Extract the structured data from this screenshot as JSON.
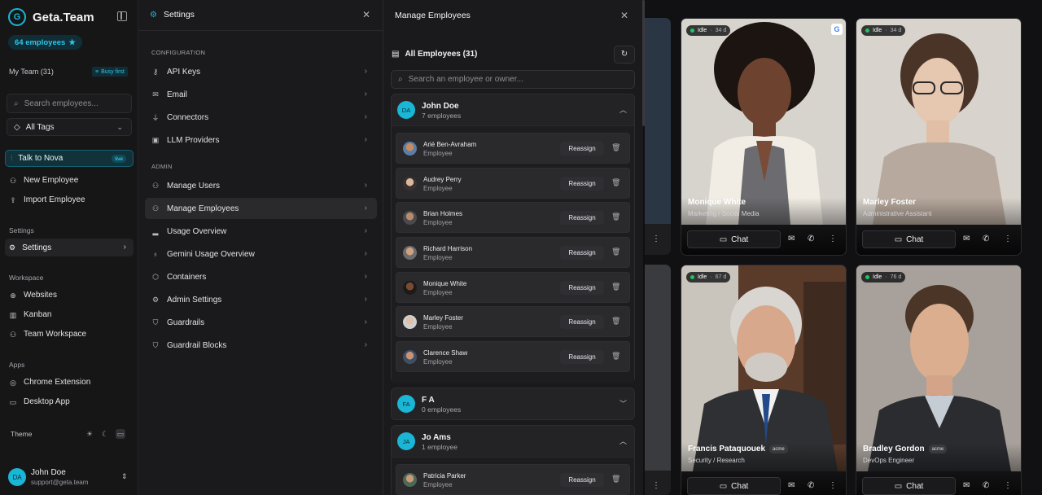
{
  "sidebar": {
    "brand": "Geta.Team",
    "logo_letter": "G",
    "employee_count": "64 employees",
    "my_team": "My Team (31)",
    "busy_first": "Busy first",
    "search_placeholder": "Search employees...",
    "tags_select": "All Tags",
    "talk_nova": "Talk to Nova",
    "live": "live",
    "new_employee": "New Employee",
    "import_employee": "Import Employee",
    "settings_section": "Settings",
    "settings_item": "Settings",
    "workspace_section": "Workspace",
    "websites": "Websites",
    "kanban": "Kanban",
    "team_workspace": "Team Workspace",
    "apps_section": "Apps",
    "chrome_extension": "Chrome Extension",
    "desktop_app": "Desktop App",
    "theme": "Theme",
    "user": {
      "initials": "DA",
      "name": "John Doe",
      "email": "support@geta.team"
    }
  },
  "settings": {
    "title": "Settings",
    "configuration_label": "CONFIGURATION",
    "configuration": [
      "API Keys",
      "Email",
      "Connectors",
      "LLM Providers"
    ],
    "admin_label": "ADMIN",
    "admin": [
      "Manage Users",
      "Manage Employees",
      "Usage Overview",
      "Gemini Usage Overview",
      "Containers",
      "Admin Settings",
      "Guardrails",
      "Guardrail Blocks"
    ]
  },
  "manage": {
    "title": "Manage Employees",
    "all_employees": "All Employees (31)",
    "search_placeholder": "Search an employee or owner...",
    "reassign": "Reassign",
    "groups": [
      {
        "initials": "DA",
        "name": "John Doe",
        "count": "7 employees",
        "employees": [
          {
            "name": "Arié Ben-Avraham",
            "role": "Employee"
          },
          {
            "name": "Audrey Perry",
            "role": "Employee"
          },
          {
            "name": "Brian Holmes",
            "role": "Employee"
          },
          {
            "name": "Richard Harrison",
            "role": "Employee"
          },
          {
            "name": "Monique White",
            "role": "Employee"
          },
          {
            "name": "Marley Foster",
            "role": "Employee"
          },
          {
            "name": "Clarence Shaw",
            "role": "Employee"
          }
        ]
      },
      {
        "initials": "FA",
        "name": "F A",
        "count": "0 employees",
        "employees": []
      },
      {
        "initials": "JA",
        "name": "Jo Ams",
        "count": "1 employee",
        "employees": [
          {
            "name": "Patricia Parker",
            "role": "Employee"
          }
        ]
      }
    ]
  },
  "cards": [
    {
      "status": "Idle",
      "duration": "34 d",
      "name": "Monique White",
      "role": "Marketing / Social Media",
      "tag": "",
      "chat": "Chat",
      "google": "G"
    },
    {
      "status": "Idle",
      "duration": "34 d",
      "name": "Marley Foster",
      "role": "Administrative Assistant",
      "tag": "",
      "chat": "Chat"
    },
    {
      "status": "Idle",
      "duration": "67 d",
      "name": "Francis Pataquouek",
      "role": "Security / Research",
      "tag": "acme",
      "chat": "Chat"
    },
    {
      "status": "Idle",
      "duration": "76 d",
      "name": "Bradley Gordon",
      "role": "DevOps Engineer",
      "tag": "acme",
      "chat": "Chat"
    }
  ],
  "colors": {
    "accent": "#19b6d6",
    "idle_dot": "#22c55e"
  }
}
